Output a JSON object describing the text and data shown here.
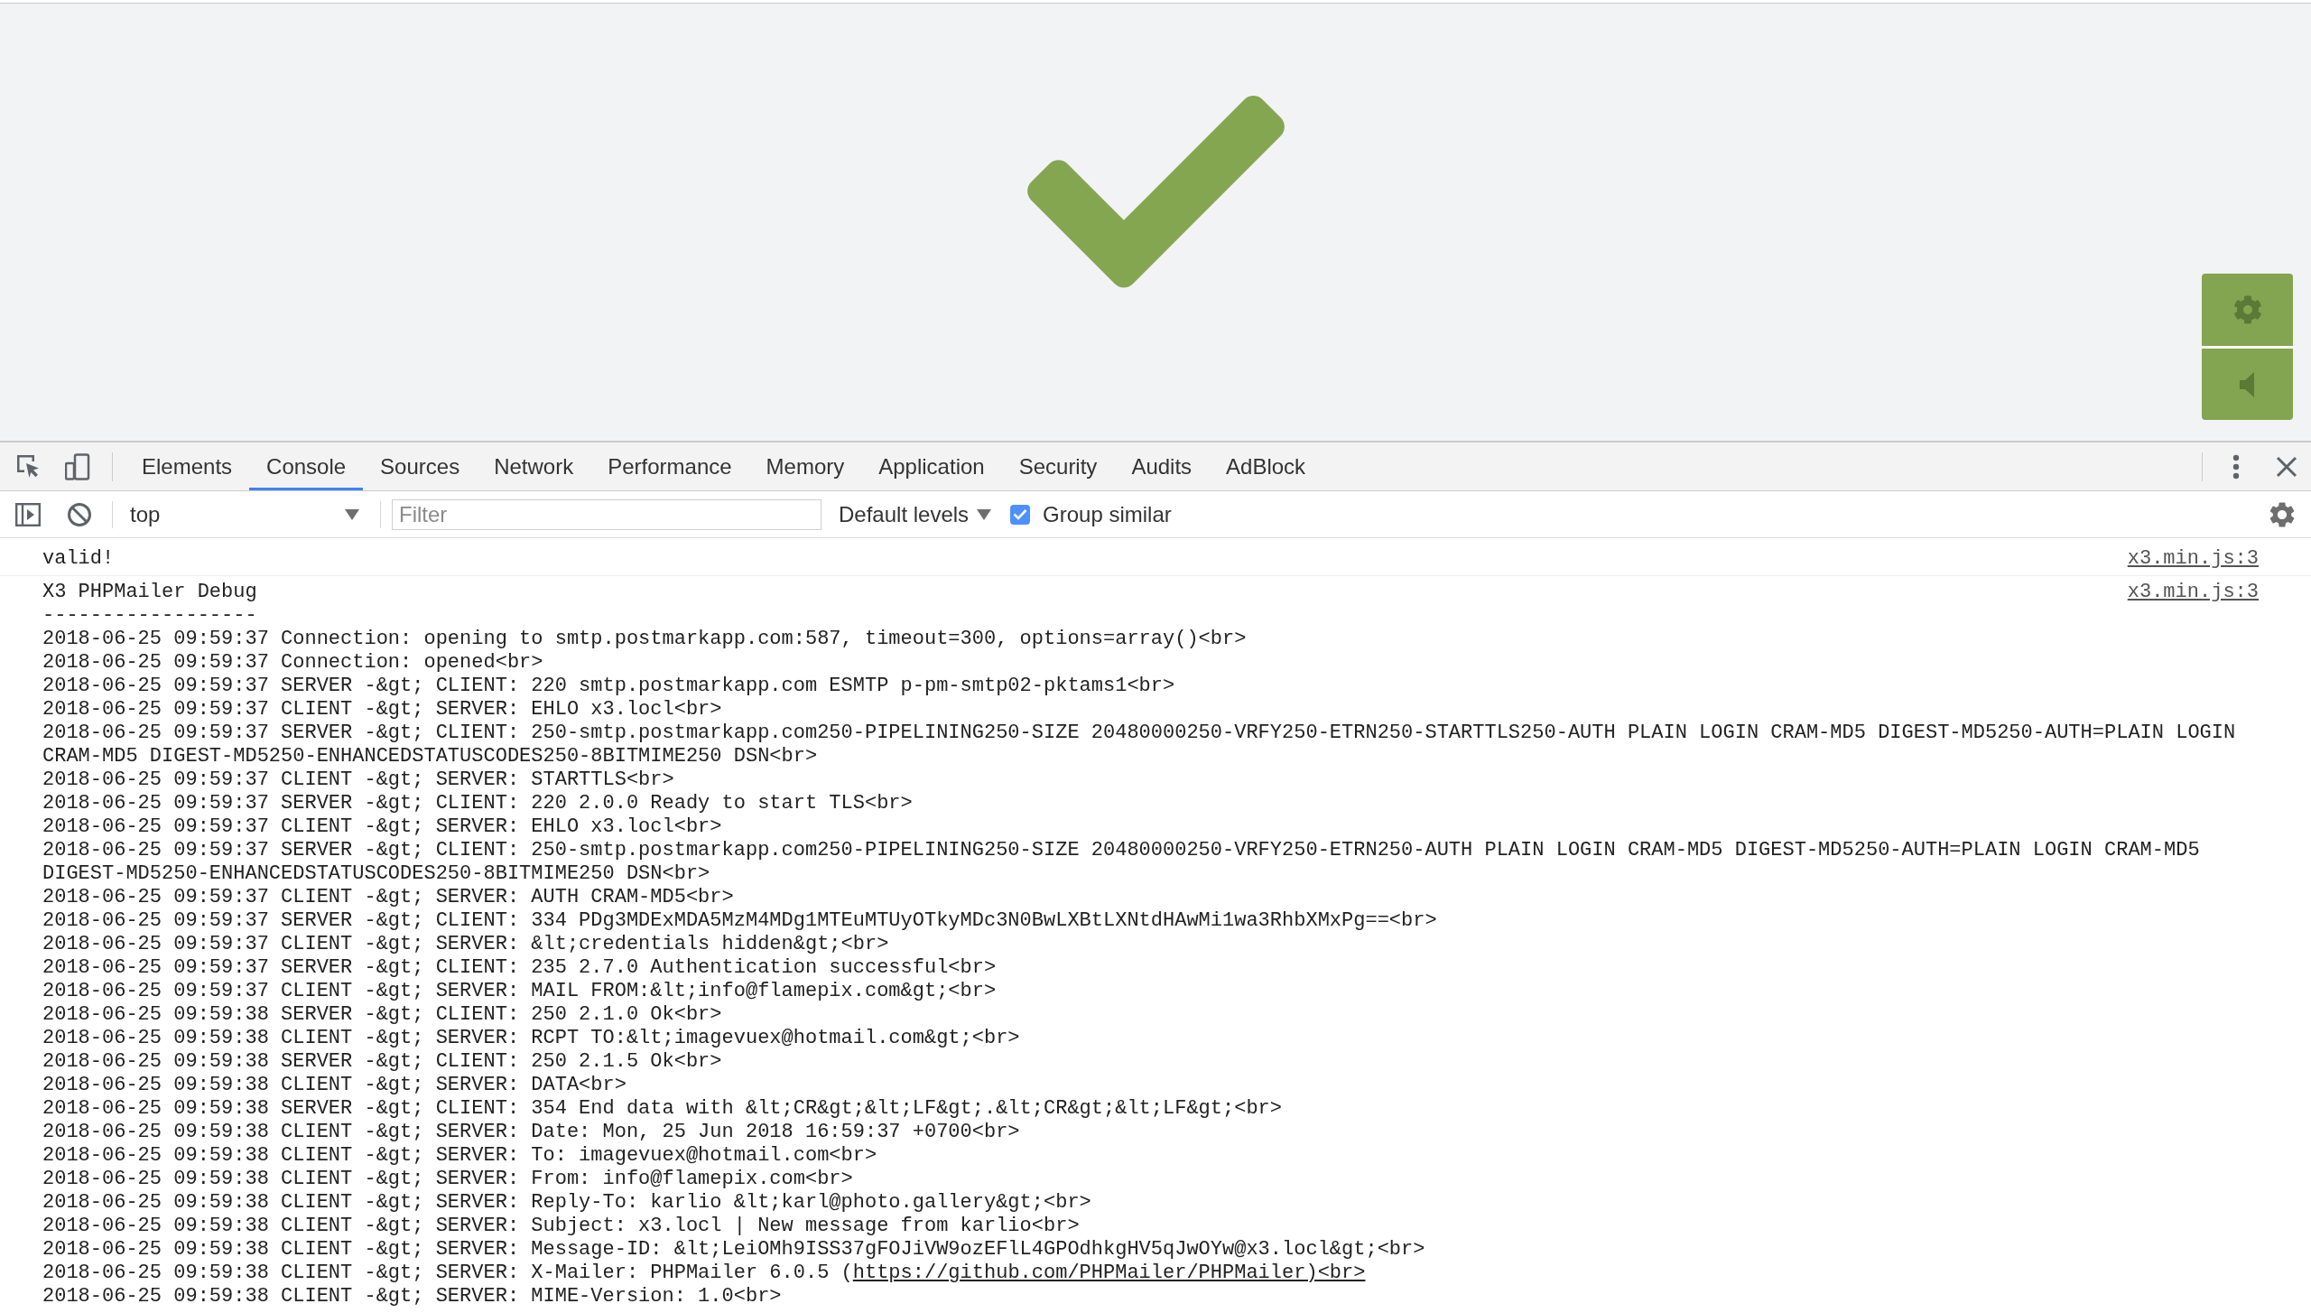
{
  "devtools": {
    "tabs": [
      {
        "label": "Elements",
        "selected": false
      },
      {
        "label": "Console",
        "selected": true
      },
      {
        "label": "Sources",
        "selected": false
      },
      {
        "label": "Network",
        "selected": false
      },
      {
        "label": "Performance",
        "selected": false
      },
      {
        "label": "Memory",
        "selected": false
      },
      {
        "label": "Application",
        "selected": false
      },
      {
        "label": "Security",
        "selected": false
      },
      {
        "label": "Audits",
        "selected": false
      },
      {
        "label": "AdBlock",
        "selected": false
      }
    ],
    "toolbar": {
      "context": "top",
      "filter": {
        "placeholder": "Filter"
      },
      "levels": "Default levels",
      "group_similar": {
        "label": "Group similar",
        "checked": true
      }
    },
    "console": {
      "messages": [
        {
          "source": "x3.min.js:3",
          "lines": [
            {
              "text": "valid!"
            }
          ]
        },
        {
          "source": "x3.min.js:3",
          "lines": [
            {
              "text": "X3 PHPMailer Debug"
            },
            {
              "text": "------------------"
            },
            {
              "text": "2018-06-25 09:59:37 Connection: opening to smtp.postmarkapp.com:587, timeout=300, options=array()<br>"
            },
            {
              "text": "2018-06-25 09:59:37 Connection: opened<br>"
            },
            {
              "text": "2018-06-25 09:59:37 SERVER -&gt; CLIENT: 220 smtp.postmarkapp.com ESMTP p-pm-smtp02-pktams1<br>"
            },
            {
              "text": "2018-06-25 09:59:37 CLIENT -&gt; SERVER: EHLO x3.locl<br>"
            },
            {
              "text": "2018-06-25 09:59:37 SERVER -&gt; CLIENT: 250-smtp.postmarkapp.com250-PIPELINING250-SIZE 20480000250-VRFY250-ETRN250-STARTTLS250-AUTH PLAIN LOGIN CRAM-MD5 DIGEST-MD5250-AUTH=PLAIN LOGIN CRAM-MD5 DIGEST-MD5250-ENHANCEDSTATUSCODES250-8BITMIME250 DSN<br>"
            },
            {
              "text": "2018-06-25 09:59:37 CLIENT -&gt; SERVER: STARTTLS<br>"
            },
            {
              "text": "2018-06-25 09:59:37 SERVER -&gt; CLIENT: 220 2.0.0 Ready to start TLS<br>"
            },
            {
              "text": "2018-06-25 09:59:37 CLIENT -&gt; SERVER: EHLO x3.locl<br>"
            },
            {
              "text": "2018-06-25 09:59:37 SERVER -&gt; CLIENT: 250-smtp.postmarkapp.com250-PIPELINING250-SIZE 20480000250-VRFY250-ETRN250-AUTH PLAIN LOGIN CRAM-MD5 DIGEST-MD5250-AUTH=PLAIN LOGIN CRAM-MD5 DIGEST-MD5250-ENHANCEDSTATUSCODES250-8BITMIME250 DSN<br>"
            },
            {
              "text": "2018-06-25 09:59:37 CLIENT -&gt; SERVER: AUTH CRAM-MD5<br>"
            },
            {
              "text": "2018-06-25 09:59:37 SERVER -&gt; CLIENT: 334 PDg3MDExMDA5MzM4MDg1MTEuMTUyOTkyMDc3N0BwLXBtLXNtdHAwMi1wa3RhbXMxPg==<br>"
            },
            {
              "text": "2018-06-25 09:59:37 CLIENT -&gt; SERVER: &lt;credentials hidden&gt;<br>"
            },
            {
              "text": "2018-06-25 09:59:37 SERVER -&gt; CLIENT: 235 2.7.0 Authentication successful<br>"
            },
            {
              "text": "2018-06-25 09:59:37 CLIENT -&gt; SERVER: MAIL FROM:&lt;info@flamepix.com&gt;<br>"
            },
            {
              "text": "2018-06-25 09:59:38 SERVER -&gt; CLIENT: 250 2.1.0 Ok<br>"
            },
            {
              "text": "2018-06-25 09:59:38 CLIENT -&gt; SERVER: RCPT TO:&lt;imagevuex@hotmail.com&gt;<br>"
            },
            {
              "text": "2018-06-25 09:59:38 SERVER -&gt; CLIENT: 250 2.1.5 Ok<br>"
            },
            {
              "text": "2018-06-25 09:59:38 CLIENT -&gt; SERVER: DATA<br>"
            },
            {
              "text": "2018-06-25 09:59:38 SERVER -&gt; CLIENT: 354 End data with &lt;CR&gt;&lt;LF&gt;.&lt;CR&gt;&lt;LF&gt;<br>"
            },
            {
              "text": "2018-06-25 09:59:38 CLIENT -&gt; SERVER: Date: Mon, 25 Jun 2018 16:59:37 +0700<br>"
            },
            {
              "text": "2018-06-25 09:59:38 CLIENT -&gt; SERVER: To: imagevuex@hotmail.com<br>"
            },
            {
              "text": "2018-06-25 09:59:38 CLIENT -&gt; SERVER: From: info@flamepix.com<br>"
            },
            {
              "text": "2018-06-25 09:59:38 CLIENT -&gt; SERVER: Reply-To: karlio &lt;karl@photo.gallery&gt;<br>"
            },
            {
              "text": "2018-06-25 09:59:38 CLIENT -&gt; SERVER: Subject: x3.locl | New message from karlio<br>"
            },
            {
              "text": "2018-06-25 09:59:38 CLIENT -&gt; SERVER: Message-ID: &lt;LeiOMh9ISS37gFOJiVW9ozEFlL4GPOdhkgHV5qJwOYw@x3.locl&gt;<br>"
            },
            {
              "text": "2018-06-25 09:59:38 CLIENT -&gt; SERVER: X-Mailer: PHPMailer 6.0.5 (",
              "link": "https://github.com/PHPMailer/PHPMailer)<br>"
            },
            {
              "text": "2018-06-25 09:59:38 CLIENT -&gt; SERVER: MIME-Version: 1.0<br>"
            }
          ]
        }
      ]
    }
  }
}
